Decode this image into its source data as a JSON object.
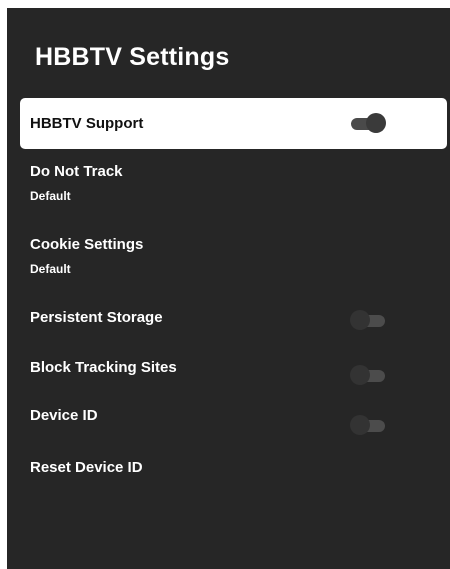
{
  "screen": {
    "title": "HBBTV Settings"
  },
  "items": [
    {
      "label": "HBBTV Support",
      "toggle": "on",
      "focused": true
    },
    {
      "label": "Do Not Track",
      "value": "Default"
    },
    {
      "label": "Cookie Settings",
      "value": "Default"
    },
    {
      "label": "Persistent Storage",
      "toggle": "off"
    },
    {
      "label": "Block Tracking Sites",
      "toggle": "off"
    },
    {
      "label": "Device ID",
      "toggle": "off"
    },
    {
      "label": "Reset Device ID"
    }
  ],
  "colors": {
    "background": "#262626",
    "focused_row": "#ffffff",
    "text": "#ffffff"
  }
}
